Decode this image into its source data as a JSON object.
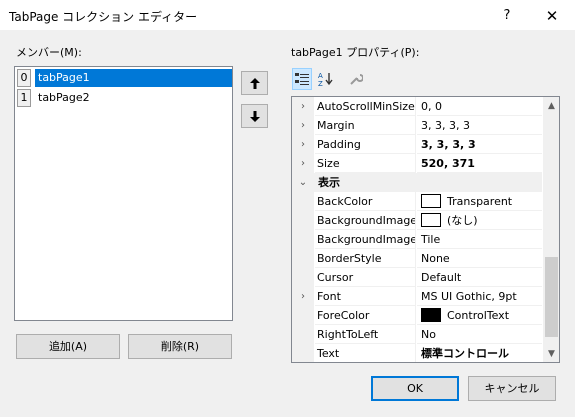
{
  "window": {
    "title": "TabPage コレクション エディター",
    "help": "?",
    "close": "✕"
  },
  "members": {
    "label": "メンバー(M):",
    "items": [
      {
        "index": "0",
        "name": "tabPage1",
        "selected": true
      },
      {
        "index": "1",
        "name": "tabPage2",
        "selected": false
      }
    ]
  },
  "buttons": {
    "add": "追加(A)",
    "delete": "削除(R)",
    "ok": "OK",
    "cancel": "キャンセル"
  },
  "properties": {
    "label": "tabPage1 プロパティ(P):",
    "rows": [
      {
        "name": "AutoScrollMinSize",
        "value": "0, 0",
        "expand": "›"
      },
      {
        "name": "Margin",
        "value": "3, 3, 3, 3",
        "expand": "›"
      },
      {
        "name": "Padding",
        "value": "3, 3, 3, 3",
        "expand": "›",
        "bold": true
      },
      {
        "name": "Size",
        "value": "520, 371",
        "expand": "›",
        "bold": true
      },
      {
        "category": "表示",
        "expand": "⌄"
      },
      {
        "name": "BackColor",
        "value": "Transparent",
        "swatch": "#ffffff"
      },
      {
        "name": "BackgroundImage",
        "value": "(なし)",
        "swatch": "#ffffff"
      },
      {
        "name": "BackgroundImageLayout",
        "value": "Tile"
      },
      {
        "name": "BorderStyle",
        "value": "None"
      },
      {
        "name": "Cursor",
        "value": "Default"
      },
      {
        "name": "Font",
        "value": "MS UI Gothic, 9pt",
        "expand": "›"
      },
      {
        "name": "ForeColor",
        "value": "ControlText",
        "swatch": "#000000"
      },
      {
        "name": "RightToLeft",
        "value": "No"
      },
      {
        "name": "Text",
        "value": "標準コントロール",
        "bold": true
      }
    ]
  },
  "colors": {
    "selection": "#0078d7",
    "accent_border": "#0078d7"
  }
}
